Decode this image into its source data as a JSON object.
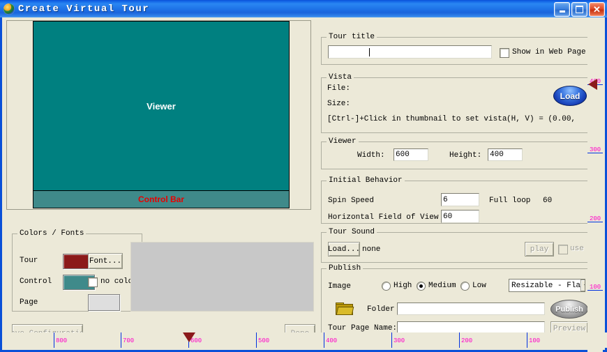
{
  "window": {
    "title": "Create Virtual Tour",
    "icon": "globe-icon",
    "minimize_label": "minimize",
    "maximize_label": "maximize",
    "close_label": "close"
  },
  "preview": {
    "viewer_label": "Viewer",
    "control_bar_label": "Control Bar",
    "viewer_color": "#008080",
    "control_bar_color": "#3f8a8a",
    "control_bar_text_color": "#e80000",
    "thumbnail_placeholder": ""
  },
  "colors_fonts": {
    "legend": "Colors / Fonts",
    "tour_label": "Tour",
    "tour_color": "#8b1a1a",
    "font_button": "Font...",
    "control_label": "Control",
    "control_color": "#3f8a8a",
    "no_color_label": "no color",
    "no_color_checked": false,
    "page_label": "Page",
    "page_color": "#dedede"
  },
  "left_buttons": {
    "save_configuration": "Save Configuration",
    "done": "Done"
  },
  "tour_title": {
    "legend": "Tour title",
    "value": "",
    "show_in_web_page_label": "Show in Web Page",
    "show_in_web_page_checked": false
  },
  "vista": {
    "legend": "Vista",
    "file_label": "File:",
    "file_value": "",
    "size_label": "Size:",
    "size_value": "",
    "hint": "[Ctrl-]+Click in thumbnail to set vista",
    "hv_text": "(H, V) = (0.00,",
    "load_button": "Load"
  },
  "viewer": {
    "legend": "Viewer",
    "width_label": "Width:",
    "width_value": "600",
    "height_label": "Height:",
    "height_value": "400"
  },
  "initial_behavior": {
    "legend": "Initial Behavior",
    "spin_speed_label": "Spin Speed",
    "spin_speed_value": "6",
    "full_loop_label": "Full loop",
    "full_loop_value": "60",
    "hfov_label": "Horizontal Field of View",
    "hfov_value": "60"
  },
  "tour_sound": {
    "legend": "Tour Sound",
    "load_button": "Load...",
    "file_name": "none",
    "play_button": "play",
    "use_label": "use",
    "use_checked": false
  },
  "publish": {
    "legend": "Publish",
    "image_label": "Image",
    "quality_options": [
      "High",
      "Medium",
      "Low"
    ],
    "quality_selected": "Medium",
    "format_selected": "Resizable - Fla",
    "folder_label": "Folder",
    "folder_value": "",
    "folder_icon": "folder-icon",
    "tour_page_name_label": "Tour Page Name:",
    "tour_page_name_value": "",
    "publish_button": "Publish",
    "preview_button": "Preview"
  },
  "rulers": {
    "bottom_ticks": [
      "800",
      "700",
      "600",
      "500",
      "400",
      "300",
      "200",
      "100"
    ],
    "right_ticks": [
      "400",
      "300",
      "200",
      "100"
    ],
    "tick_color": "#ff00c8",
    "marker_color": "#8b1a1a",
    "bottom_marker_at": "600",
    "right_marker_at": "400"
  }
}
